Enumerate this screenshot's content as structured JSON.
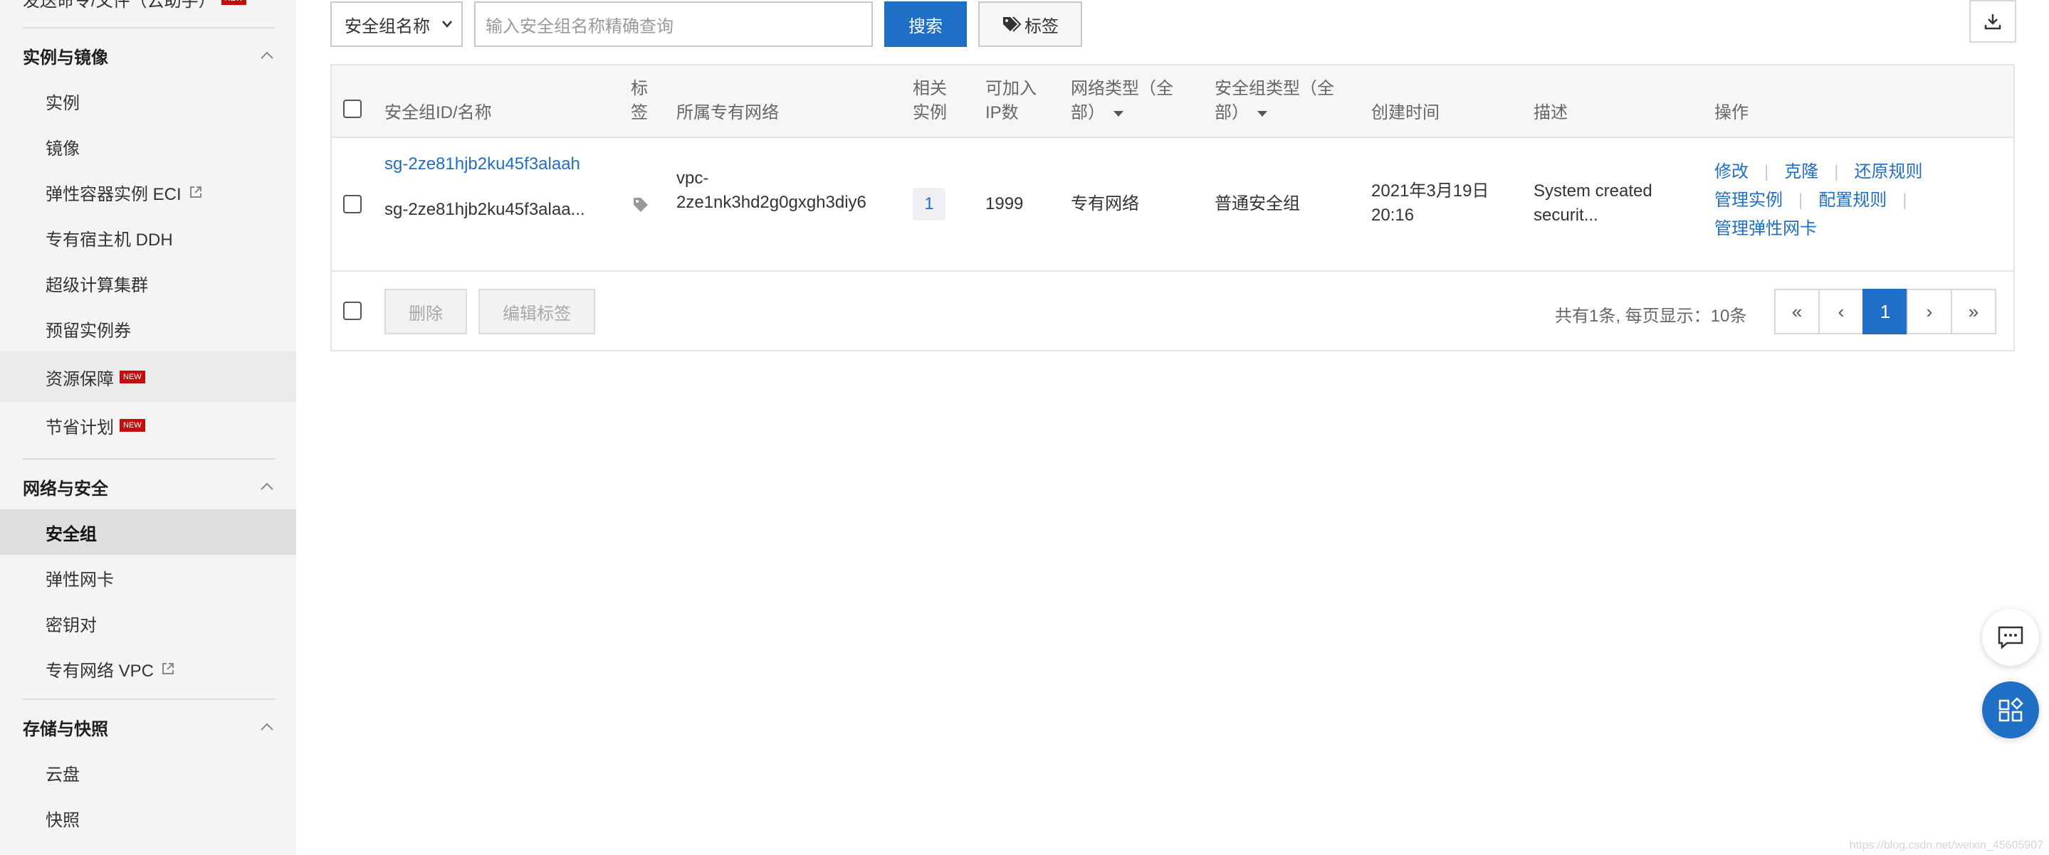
{
  "sidebar": {
    "top_cut": "发送命令/文件（云助手）",
    "sections": [
      {
        "title": "实例与镜像",
        "items": [
          "实例",
          "镜像",
          "弹性容器实例 ECI",
          "专有宿主机 DDH",
          "超级计算集群",
          "预留实例券",
          "资源保障",
          "节省计划"
        ]
      },
      {
        "title": "网络与安全",
        "items": [
          "安全组",
          "弹性网卡",
          "密钥对",
          "专有网络 VPC"
        ]
      },
      {
        "title": "存储与快照",
        "items": [
          "云盘",
          "快照"
        ]
      }
    ],
    "new_badge": "NEW"
  },
  "toolbar": {
    "select_value": "安全组名称",
    "search_placeholder": "输入安全组名称精确查询",
    "search_label": "搜索",
    "tag_label": "标签"
  },
  "table": {
    "headers": {
      "id_name": "安全组ID/名称",
      "tag_1": "标",
      "tag_2": "签",
      "vpc": "所属专有网络",
      "inst_1": "相关",
      "inst_2": "实例",
      "ip_1": "可加入",
      "ip_2": "IP数",
      "net_1": "网络类型（全",
      "net_2": "部）",
      "sgtype_1": "安全组类型（全",
      "sgtype_2": "部）",
      "created": "创建时间",
      "desc": "描述",
      "ops": "操作"
    },
    "rows": [
      {
        "id": "sg-2ze81hjb2ku45f3alaah",
        "name": "sg-2ze81hjb2ku45f3alaa...",
        "vpc_1": "vpc-",
        "vpc_2": "2ze1nk3hd2g0gxgh3diy6",
        "instances": "1",
        "ip_count": "1999",
        "net_type": "专有网络",
        "sg_type": "普通安全组",
        "created_1": "2021年3月19日",
        "created_2": "20:16",
        "desc_1": "System created",
        "desc_2": "securit...",
        "ops": {
          "modify": "修改",
          "clone": "克隆",
          "restore": "还原规则",
          "manage_inst": "管理实例",
          "config": "配置规则",
          "manage_eni": "管理弹性网卡"
        }
      }
    ],
    "footer": {
      "delete_label": "删除",
      "edit_tags_label": "编辑标签",
      "total_info": "共有1条, 每页显示：10条",
      "pages": {
        "first": "«",
        "prev": "‹",
        "current": "1",
        "next": "›",
        "last": "»"
      }
    }
  },
  "watermark": "https://blog.csdn.net/weixin_45605907",
  "colors": {
    "accent": "#1f6fc6",
    "badge": "#c40e0e"
  }
}
